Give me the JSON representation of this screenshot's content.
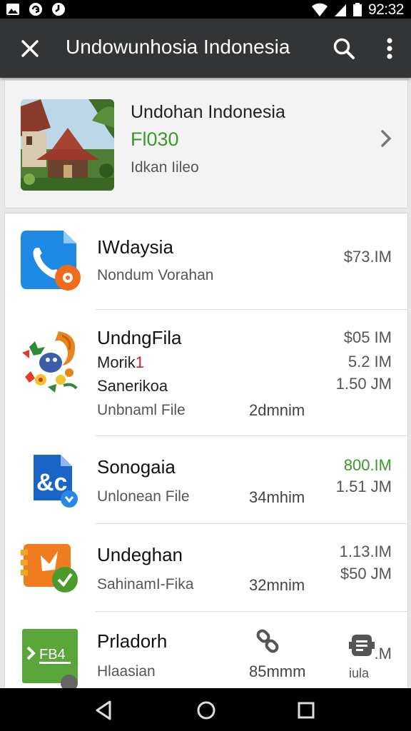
{
  "status_bar": {
    "time": "92:32",
    "icons": [
      "image-icon",
      "sync-icon",
      "clock-icon",
      "wifi-icon",
      "signal-icon",
      "battery-icon"
    ]
  },
  "app_bar": {
    "title": "Undowunhosia Indonesia",
    "close_icon": "close-icon",
    "search_icon": "search-icon",
    "more_icon": "more-vert-icon"
  },
  "header": {
    "title": "Undohan Indonesia",
    "price": "Fl030",
    "subtitle": "Idkan Iileo",
    "chevron_icon": "chevron-right-icon",
    "price_color": "#3a9a2a"
  },
  "items": [
    {
      "name": "IWdaysia",
      "subtitle": "Nondum Vorahan",
      "size": "$73.IM",
      "icon": "phone-app-icon"
    },
    {
      "name": "UndngFila",
      "line2": "Morik",
      "line2_mark": "1",
      "line3": "Sanerikoa",
      "subtitle": "Unbnaml File",
      "time": "2dmnim",
      "sizes": [
        "$05 IM",
        "5.2 IM",
        "1.50 JM"
      ],
      "icon": "floral-garuda-icon"
    },
    {
      "name": "Sonogaia",
      "subtitle": "Unlonean File",
      "time": "34mhim",
      "sizes": [
        "800.IM",
        "1.51 JM"
      ],
      "icon": "document-share-icon"
    },
    {
      "name": "Undeghan",
      "subtitle": "SahinamI-Fika",
      "time": "32mnim",
      "sizes": [
        "1.13.IM",
        "$50 JM"
      ],
      "icon": "orange-badge-icon"
    },
    {
      "name": "Prladorh",
      "subtitle": "Hlaasian",
      "time": "85mmm",
      "size": ".M",
      "extra_label": "iula",
      "icon": "green-file-icon",
      "link_icon": "link-icon",
      "robot_icon": "robot-icon"
    }
  ],
  "nav_bar": {
    "back_icon": "back-icon",
    "home_icon": "home-icon",
    "recents_icon": "recents-icon"
  },
  "colors": {
    "app_bar": "#333435",
    "accent_green": "#3a9a2a",
    "background": "#e7e7e7"
  }
}
